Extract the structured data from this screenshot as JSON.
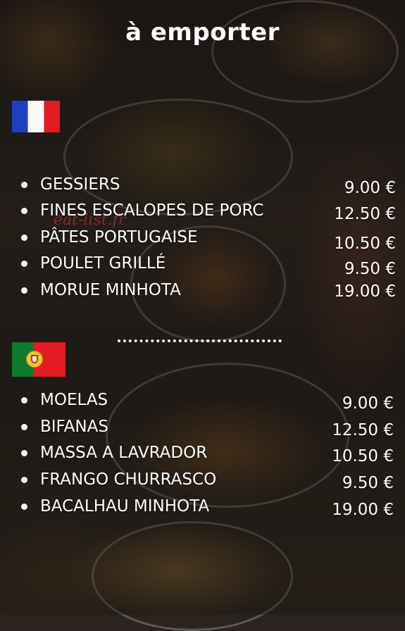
{
  "title": "à emporter",
  "watermark": "eat-list.fr",
  "sections": [
    {
      "flag": "france-flag",
      "items": [
        {
          "name": "GESSIERS",
          "price": "9.00 €"
        },
        {
          "name": "FINES ESCALOPES DE PORC",
          "price": "12.50 €"
        },
        {
          "name": "PÂTES PORTUGAISE",
          "price": "10.50 €"
        },
        {
          "name": "POULET GRILLÉ",
          "price": "9.50 €"
        },
        {
          "name": "MORUE MINHOTA",
          "price": "19.00 €"
        }
      ]
    },
    {
      "flag": "portugal-flag",
      "items": [
        {
          "name": "MOELAS",
          "price": "9.00 €"
        },
        {
          "name": "BIFANAS",
          "price": "12.50 €"
        },
        {
          "name": "MASSA A LAVRADOR",
          "price": "10.50 €"
        },
        {
          "name": "FRANGO CHURRASCO",
          "price": "9.50 €"
        },
        {
          "name": "BACALHAU MINHOTA",
          "price": "19.00 €"
        }
      ]
    }
  ],
  "colors": {
    "text": "#ffffff",
    "fr_blue": "#1f3fc0",
    "fr_red": "#e01b22",
    "pt_green": "#0f7a2d",
    "pt_red": "#e31b23"
  }
}
